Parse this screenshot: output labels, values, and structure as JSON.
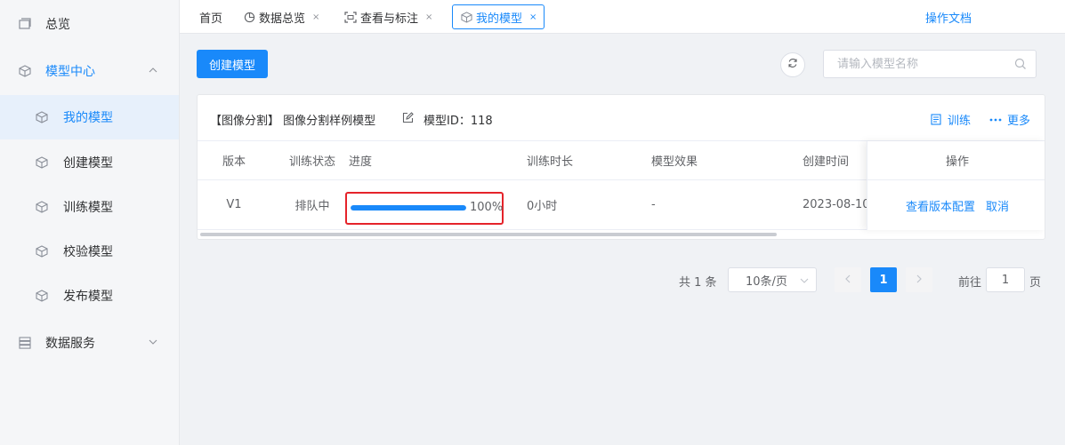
{
  "sidebar": {
    "items": [
      {
        "label": "总览",
        "icon": "overview-icon"
      },
      {
        "label": "模型中心",
        "icon": "cube-icon",
        "expanded": true
      },
      {
        "label": "我的模型",
        "icon": "cube-icon",
        "active": true
      },
      {
        "label": "创建模型",
        "icon": "cube-icon"
      },
      {
        "label": "训练模型",
        "icon": "cube-icon"
      },
      {
        "label": "校验模型",
        "icon": "cube-icon"
      },
      {
        "label": "发布模型",
        "icon": "cube-icon"
      },
      {
        "label": "数据服务",
        "icon": "server-icon",
        "expanded": false
      }
    ]
  },
  "tabs": [
    {
      "label": "首页",
      "closable": false
    },
    {
      "label": "数据总览",
      "icon": "pie-chart-icon",
      "closable": true
    },
    {
      "label": "查看与标注",
      "icon": "scan-icon",
      "closable": true
    },
    {
      "label": "我的模型",
      "icon": "cube-icon",
      "closable": true,
      "active": true
    }
  ],
  "tab_close_glyph": "×",
  "header": {
    "doc_link": "操作文档"
  },
  "toolbar": {
    "create_label": "创建模型",
    "search_placeholder": "请输入模型名称",
    "search_value": ""
  },
  "model_card": {
    "title": "【图像分割】 图像分割样例模型",
    "model_id": "模型ID：118",
    "actions": {
      "train": "训练",
      "more": "更多"
    }
  },
  "table": {
    "headers": {
      "version": "版本",
      "status": "训练状态",
      "progress": "进度",
      "duration": "训练时长",
      "effect": "模型效果",
      "created": "创建时间",
      "ops": "操作"
    },
    "rows": [
      {
        "version": "V1",
        "status": "排队中",
        "progress_percent": 100,
        "progress_text": "100%",
        "duration": "0小时",
        "effect": "-",
        "created": "2023-08-10",
        "ops": [
          "查看版本配置",
          "取消"
        ]
      }
    ]
  },
  "pagination": {
    "total": "共 1 条",
    "page_size": "10条/页",
    "current_page": "1",
    "goto_label": "前往",
    "goto_value": "1",
    "page_suffix": "页"
  },
  "colors": {
    "accent": "#1989fa",
    "highlight_box": "#e5232a",
    "sidebar_bg": "#f5f6f8",
    "main_bg": "#f0f2f5"
  }
}
